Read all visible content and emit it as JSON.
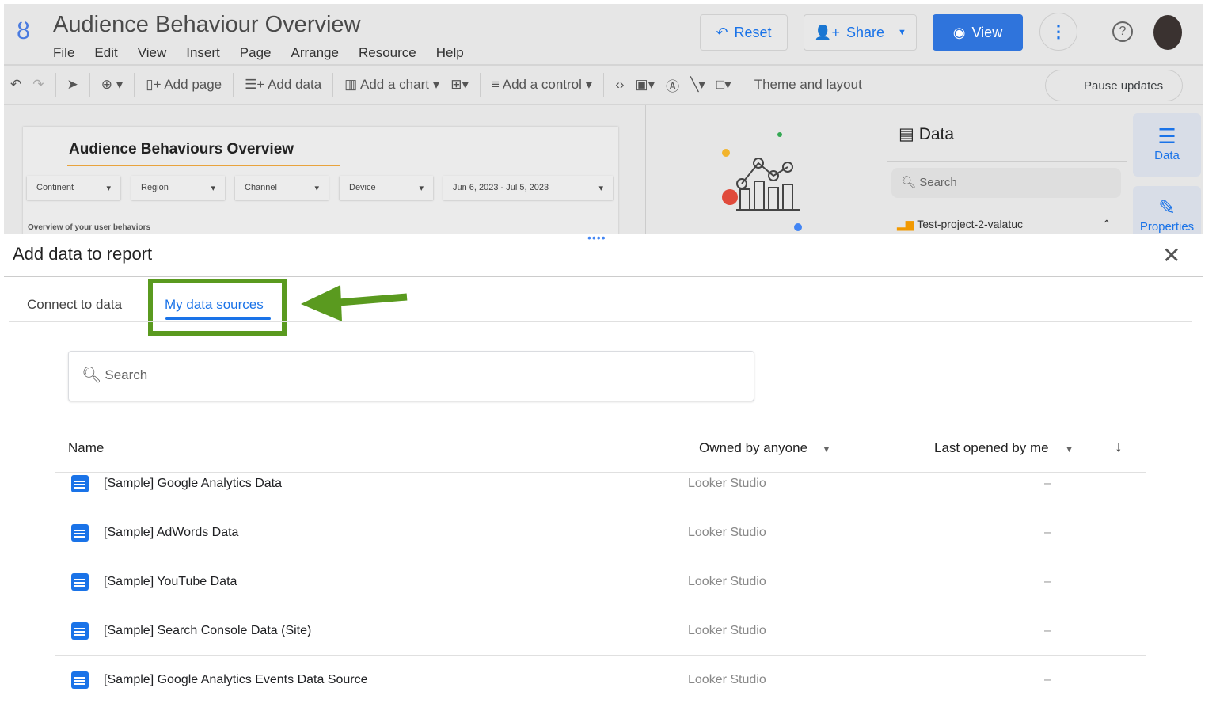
{
  "app": {
    "title": "Audience Behaviour Overview",
    "menu": [
      "File",
      "Edit",
      "View",
      "Insert",
      "Page",
      "Arrange",
      "Resource",
      "Help"
    ],
    "buttons": {
      "reset": "Reset",
      "share": "Share",
      "view": "View"
    },
    "toolbar": {
      "add_page": "Add page",
      "add_data": "Add data",
      "add_chart": "Add a chart",
      "add_control": "Add a control",
      "theme": "Theme and layout",
      "pause": "Pause updates"
    }
  },
  "canvas": {
    "report_title": "Audience Behaviours Overview",
    "controls": [
      "Continent",
      "Region",
      "Channel",
      "Device",
      "Jun 6, 2023 - Jul 5, 2023"
    ],
    "subtitle": "Overview of your user behaviors"
  },
  "data_panel": {
    "title": "Data",
    "search_placeholder": "Search",
    "source": "Test-project-2-valatuc",
    "rail": {
      "data": "Data",
      "properties": "Properties"
    }
  },
  "dialog": {
    "title": "Add data to report",
    "tabs": [
      {
        "label": "Connect to data",
        "active": false
      },
      {
        "label": "My data sources",
        "active": true
      }
    ],
    "search_placeholder": "Search",
    "columns": {
      "name": "Name",
      "owner": "Owned by anyone",
      "last_opened": "Last opened by me"
    },
    "rows": [
      {
        "name": "[Sample] Google Analytics Data",
        "owner": "Looker Studio",
        "last_opened": "–"
      },
      {
        "name": "[Sample] AdWords Data",
        "owner": "Looker Studio",
        "last_opened": "–"
      },
      {
        "name": "[Sample] YouTube Data",
        "owner": "Looker Studio",
        "last_opened": "–"
      },
      {
        "name": "[Sample] Search Console Data (Site)",
        "owner": "Looker Studio",
        "last_opened": "–"
      },
      {
        "name": "[Sample] Google Analytics Events Data Source",
        "owner": "Looker Studio",
        "last_opened": "–"
      }
    ]
  },
  "colors": {
    "accent": "#1a73e8",
    "highlight": "#5a9a1f"
  }
}
